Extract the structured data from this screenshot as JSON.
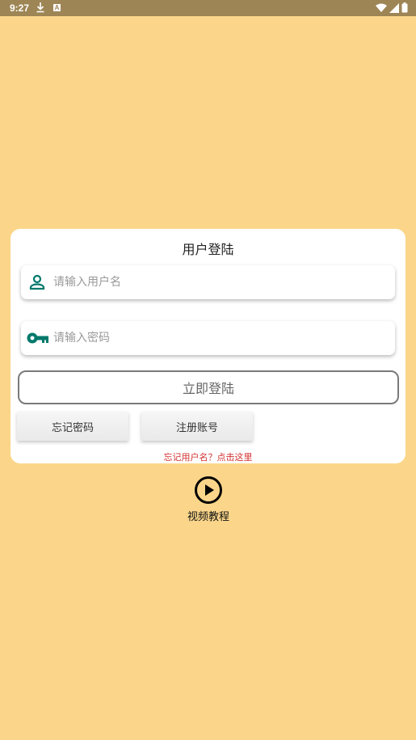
{
  "status_bar": {
    "time": "9:27",
    "icons": [
      "download-icon",
      "a-icon",
      "wifi-icon",
      "signal-icon",
      "battery-icon"
    ]
  },
  "login_card": {
    "title": "用户登陆",
    "username_placeholder": "请输入用户名",
    "password_placeholder": "请输入密码",
    "login_button": "立即登陆",
    "forgot_password_button": "忘记密码",
    "register_button": "注册账号",
    "forgot_username_link": "忘记用户名？点击这里"
  },
  "video_tutorial": {
    "label": "视频教程"
  },
  "colors": {
    "background": "#FBD68A",
    "status_bar": "#9E8555",
    "icon_teal": "#00796B",
    "link_red": "#D32F2F"
  }
}
